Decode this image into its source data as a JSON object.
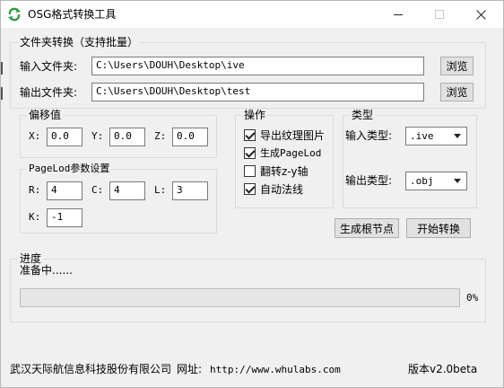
{
  "window": {
    "title": "OSG格式转换工具"
  },
  "folder_group": {
    "legend": "文件夹转换（支持批量）",
    "input_label": "输入文件夹:",
    "input_value": "C:\\Users\\DOUH\\Desktop\\ive",
    "output_label": "输出文件夹:",
    "output_value": "C:\\Users\\DOUH\\Desktop\\test",
    "browse_label": "浏览"
  },
  "offset_group": {
    "legend": "偏移值",
    "x_label": "X:",
    "x_value": "0.0",
    "y_label": "Y:",
    "y_value": "0.0",
    "z_label": "Z:",
    "z_value": "0.0"
  },
  "pagelod_group": {
    "legend": "PageLod参数设置",
    "r_label": "R:",
    "r_value": "4",
    "c_label": "C:",
    "c_value": "4",
    "l_label": "L:",
    "l_value": "3",
    "k_label": "K:",
    "k_value": "-1"
  },
  "operations_group": {
    "legend": "操作",
    "options": [
      {
        "label": "导出纹理图片",
        "checked": true
      },
      {
        "label": "生成PageLod",
        "checked": true
      },
      {
        "label": "翻转z-y轴",
        "checked": false
      },
      {
        "label": "自动法线",
        "checked": true
      }
    ]
  },
  "type_group": {
    "legend": "类型",
    "input_type_label": "输入类型:",
    "input_type_value": ".ive",
    "output_type_label": "输出类型:",
    "output_type_value": ".obj"
  },
  "actions": {
    "generate_root_label": "生成根节点",
    "start_convert_label": "开始转换"
  },
  "progress_group": {
    "legend": "进度",
    "status": "准备中......",
    "percent_text": "0%",
    "progress_fraction": 0
  },
  "footer": {
    "company": "武汉天际航信息科技股份有限公司",
    "website_label": "网址:",
    "website_url": "http://www.whulabs.com",
    "version": "版本v2.0beta"
  }
}
